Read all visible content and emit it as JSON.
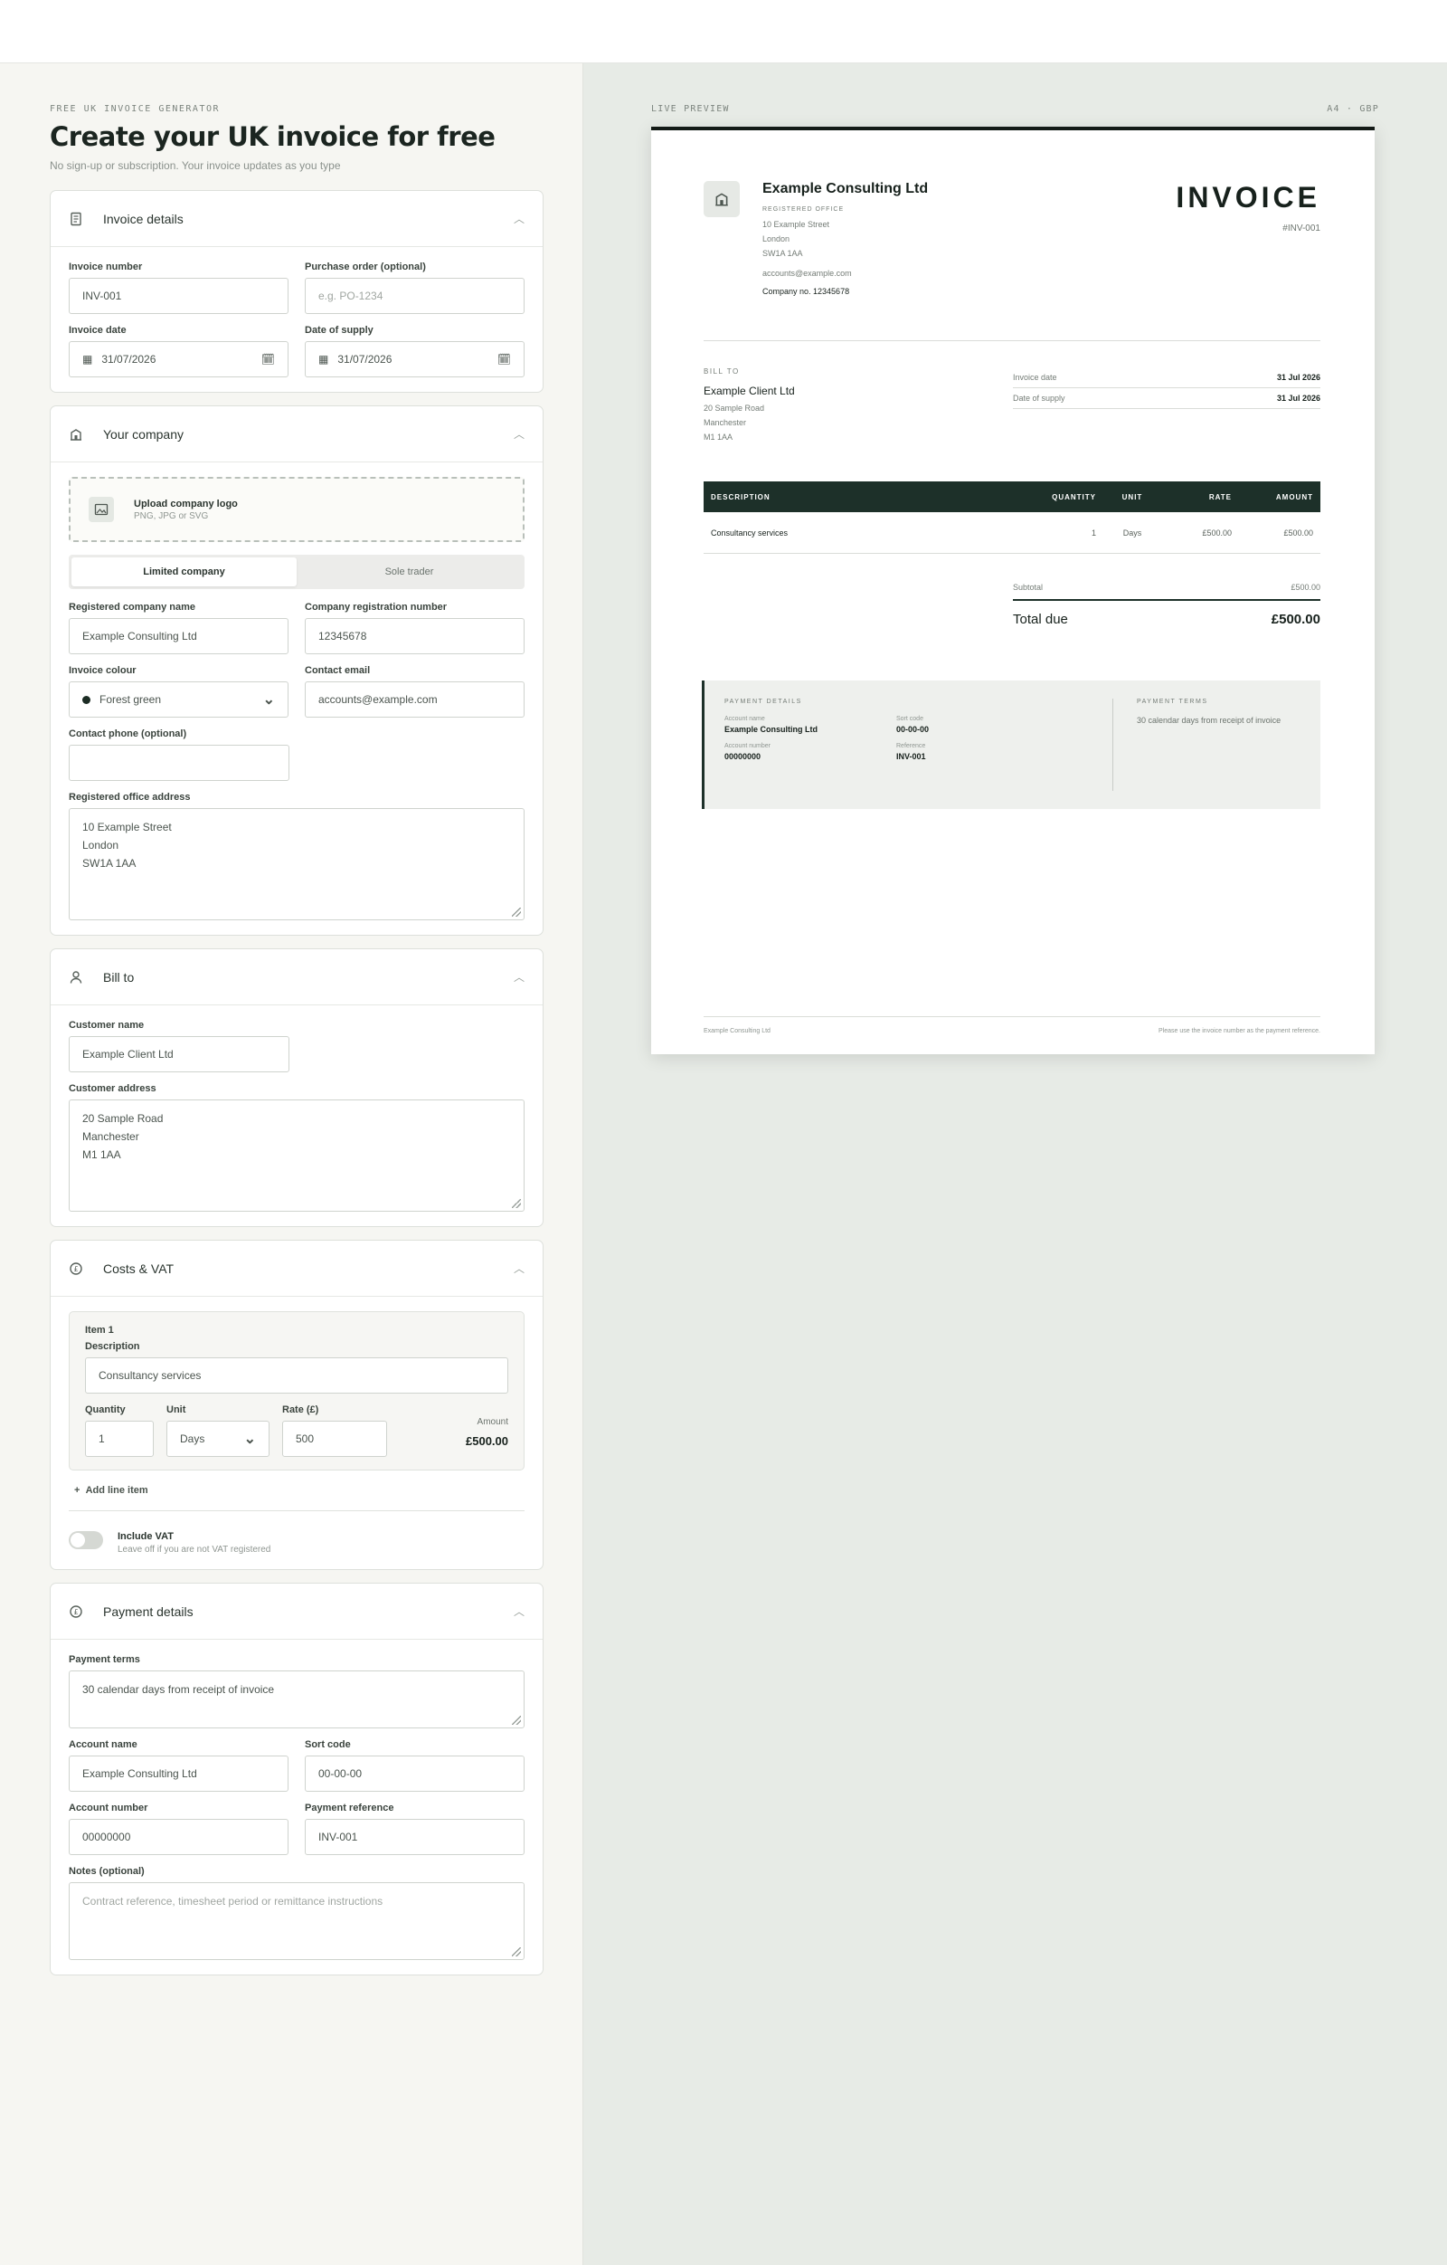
{
  "header": {
    "eyebrow": "FREE UK INVOICE GENERATOR",
    "title": "Create your UK invoice for free",
    "subtitle": "No sign-up or subscription. Your invoice updates as you type"
  },
  "invoice_details": {
    "title": "Invoice details",
    "number_label": "Invoice number",
    "number_value": "INV-001",
    "po_label": "Purchase order (optional)",
    "po_placeholder": "e.g. PO-1234",
    "date_label": "Invoice date",
    "date_value": "31/07/2026",
    "supply_label": "Date of supply",
    "supply_value": "31/07/2026"
  },
  "company": {
    "title": "Your company",
    "upload_label": "Upload company logo",
    "upload_hint": "PNG, JPG or SVG",
    "type_options": [
      "Limited company",
      "Sole trader"
    ],
    "name_label": "Registered company name",
    "name_value": "Example Consulting Ltd",
    "reg_label": "Company registration number",
    "reg_value": "12345678",
    "colour_label": "Invoice colour",
    "colour_value": "Forest green",
    "email_label": "Contact email",
    "email_value": "accounts@example.com",
    "phone_label": "Contact phone (optional)",
    "phone_value": "",
    "address_label": "Registered office address",
    "address_value": "10 Example Street\nLondon\nSW1A 1AA"
  },
  "bill_to": {
    "title": "Bill to",
    "name_label": "Customer name",
    "name_value": "Example Client Ltd",
    "address_label": "Customer address",
    "address_value": "20 Sample Road\nManchester\nM1 1AA"
  },
  "costs": {
    "title": "Costs & VAT",
    "item_label": "Item 1",
    "desc_label": "Description",
    "desc_value": "Consultancy services",
    "qty_label": "Quantity",
    "qty_value": "1",
    "unit_label": "Unit",
    "unit_value": "Days",
    "rate_label": "Rate (£)",
    "rate_value": "500",
    "amount_label": "Amount",
    "amount_value": "£500.00",
    "add_line": "Add line item",
    "vat_label": "Include VAT",
    "vat_hint": "Leave off if you are not VAT registered"
  },
  "payment": {
    "title": "Payment details",
    "terms_label": "Payment terms",
    "terms_value": "30 calendar days from receipt of invoice",
    "acc_name_label": "Account name",
    "acc_name_value": "Example Consulting Ltd",
    "sort_label": "Sort code",
    "sort_value": "00-00-00",
    "acc_num_label": "Account number",
    "acc_num_value": "00000000",
    "ref_label": "Payment reference",
    "ref_value": "INV-001",
    "notes_label": "Notes (optional)",
    "notes_placeholder": "Contract reference, timesheet period or remittance instructions"
  },
  "preview": {
    "label": "LIVE PREVIEW",
    "meta": "A4 · GBP",
    "company_name": "Example Consulting Ltd",
    "office_caption": "REGISTERED OFFICE",
    "address_lines": [
      "10 Example Street",
      "London",
      "SW1A 1AA"
    ],
    "email": "accounts@example.com",
    "company_no": "Company no. 12345678",
    "heading": "INVOICE",
    "number": "#INV-001",
    "bill_caption": "BILL TO",
    "client_name": "Example Client Ltd",
    "client_lines": [
      "20 Sample Road",
      "Manchester",
      "M1 1AA"
    ],
    "invoice_date_label": "Invoice date",
    "invoice_date_value": "31 Jul 2026",
    "supply_label": "Date of supply",
    "supply_value": "31 Jul 2026",
    "cols": [
      "DESCRIPTION",
      "QUANTITY",
      "UNIT",
      "RATE",
      "AMOUNT"
    ],
    "row": [
      "Consultancy services",
      "1",
      "Days",
      "£500.00",
      "£500.00"
    ],
    "subtotal_label": "Subtotal",
    "subtotal_value": "£500.00",
    "total_label": "Total due",
    "total_value": "£500.00",
    "pay_caption": "PAYMENT DETAILS",
    "acc_name_k": "Account name",
    "acc_name_v": "Example Consulting Ltd",
    "sort_k": "Sort code",
    "sort_v": "00-00-00",
    "acc_num_k": "Account number",
    "acc_num_v": "00000000",
    "ref_k": "Reference",
    "ref_v": "INV-001",
    "terms_caption": "PAYMENT TERMS",
    "terms_v": "30 calendar days from receipt of invoice",
    "footer_left": "Example Consulting Ltd",
    "footer_right": "Please use the invoice number as the payment reference."
  },
  "colors": {
    "accent": "#1d3029",
    "panel": "#f6f6f2",
    "preview_bg": "#e7ebe6"
  }
}
